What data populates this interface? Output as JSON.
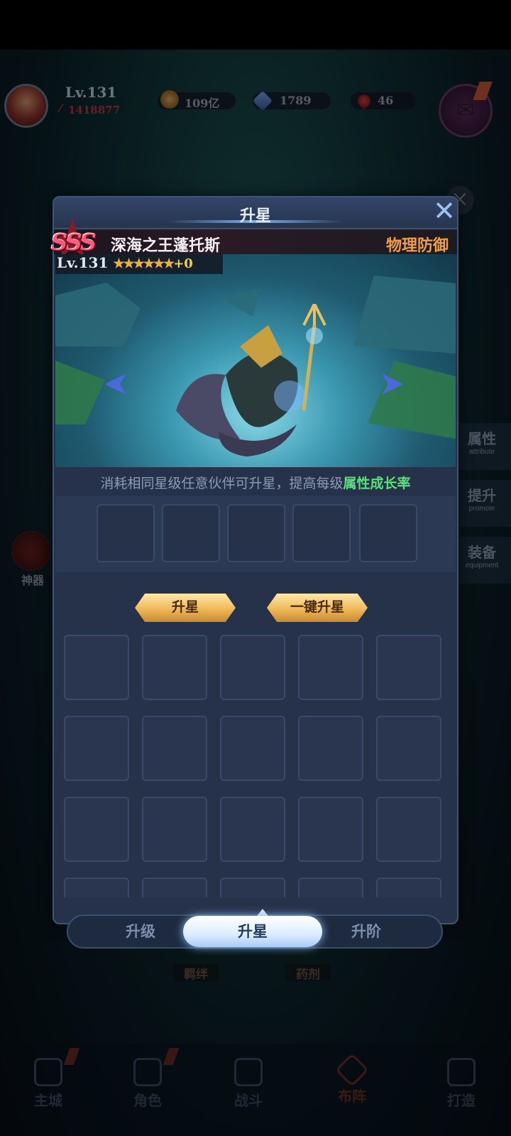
{
  "hud": {
    "level": "Lv.131",
    "power": "1418877",
    "gold": "109亿",
    "gems": "1789",
    "blood": "46"
  },
  "side_tabs": [
    {
      "cn": "属性",
      "en": "attribute"
    },
    {
      "cn": "提升",
      "en": "promote"
    },
    {
      "cn": "装备",
      "en": "equipment"
    }
  ],
  "artifact_label": "神器",
  "background_labels": [
    "羁绊",
    "药剂"
  ],
  "bottom_nav": [
    "主城",
    "角色",
    "战斗",
    "布阵",
    "打造"
  ],
  "modal": {
    "title": "升星",
    "rank": "SSS",
    "hero_name": "深海之王蓬托斯",
    "hero_type": "物理防御",
    "hero_level": "Lv.131",
    "stars": "★★★★★★",
    "star_plus": "+0",
    "desc_prefix": "消耗相同星级任意伙伴可升星，提高每级",
    "desc_highlight": "属性成长率",
    "btn_star_up": "升星",
    "btn_one_key": "一键升星",
    "tabs": [
      "升级",
      "升星",
      "升阶"
    ],
    "active_tab": "升星"
  },
  "colors": {
    "highlight_green": "#5ce07a",
    "hero_type_orange": "#f0a040",
    "button_gold": "#f0b858",
    "panel_bg": "#25324a"
  }
}
